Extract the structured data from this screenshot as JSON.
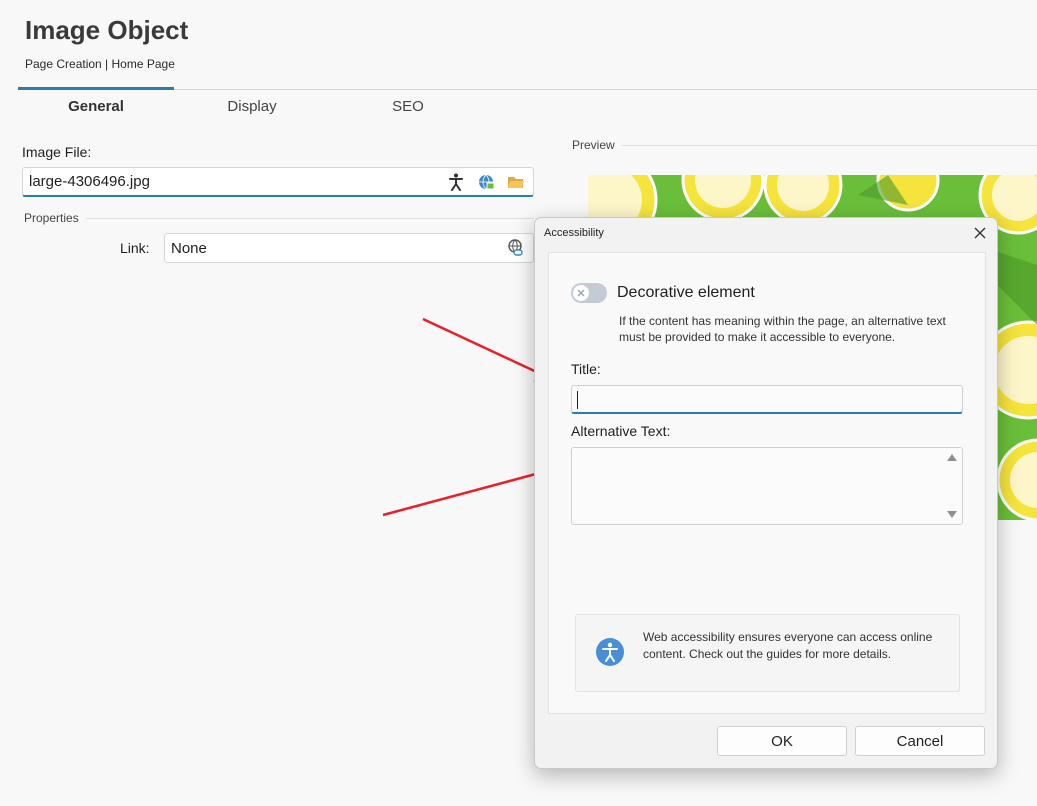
{
  "header": {
    "title": "Image Object",
    "breadcrumb": "Page Creation | Home Page"
  },
  "tabs": [
    {
      "label": "General",
      "active": true
    },
    {
      "label": "Display",
      "active": false
    },
    {
      "label": "SEO",
      "active": false
    }
  ],
  "image_file": {
    "label": "Image File:",
    "value": "large-4306496.jpg",
    "icons": [
      "accessibility-icon",
      "web-image-icon",
      "open-folder-icon"
    ]
  },
  "properties": {
    "section_label": "Properties",
    "link_label": "Link:",
    "link_value": "None",
    "link_icon": "link-icon"
  },
  "preview": {
    "label": "Preview"
  },
  "dialog": {
    "title": "Accessibility",
    "decorative_label": "Decorative element",
    "decorative_enabled": false,
    "help_text": "If the content has meaning within the page, an alternative text must be provided to make it accessible to everyone.",
    "title_label": "Title:",
    "title_value": "",
    "alt_label": "Alternative Text:",
    "alt_value": "",
    "info_text": "Web accessibility ensures everyone can access online content. Check out the guides for more details.",
    "ok_label": "OK",
    "cancel_label": "Cancel"
  },
  "colors": {
    "accent": "#2a7fa8",
    "annotation_arrow": "#e8202a",
    "preview_green": "#6abf3a",
    "lemon_yellow": "#f5e43c"
  }
}
